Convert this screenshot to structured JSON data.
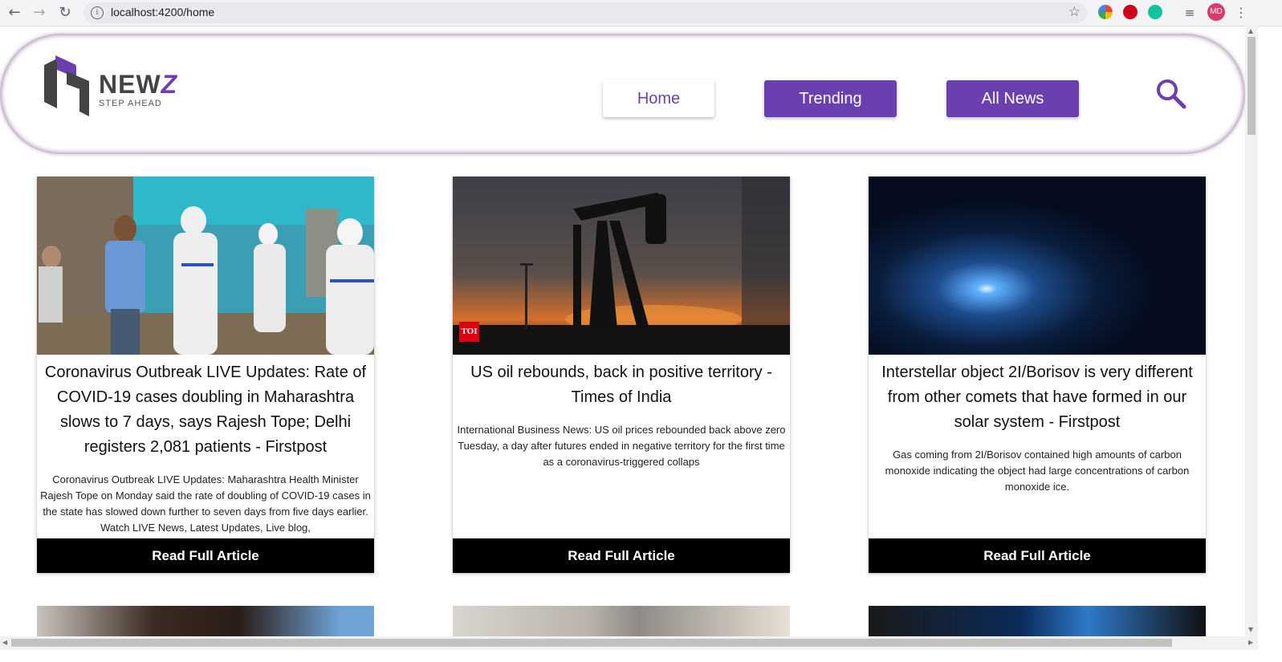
{
  "browser": {
    "url": "localhost:4200/home",
    "avatar": "MD"
  },
  "header": {
    "logo_text": "NEW",
    "logo_z": "Z",
    "tagline": "STEP AHEAD",
    "nav": [
      "Home",
      "Trending",
      "All News"
    ]
  },
  "articles": [
    {
      "title": "Coronavirus Outbreak LIVE Updates: Rate of COVID-19 cases doubling in Maharashtra slows to 7 days, says Rajesh Tope; Delhi registers 2,081 patients - Firstpost",
      "description": "Coronavirus Outbreak LIVE Updates: Maharashtra Health Minister Rajesh Tope on Monday said the rate of doubling of COVID-19 cases in the state has slowed down further to seven days from five days earlier. Watch LIVE News, Latest Updates, Live blog,",
      "button": "Read Full Article"
    },
    {
      "title": "US oil rebounds, back in positive territory - Times of India",
      "description": "International Business News: US oil prices rebounded back above zero Tuesday, a day after futures ended in negative territory for the first time as a coronavirus-triggered collaps",
      "button": "Read Full Article",
      "badge": "TOI"
    },
    {
      "title": "Interstellar object 2I/Borisov is very different from other comets that have formed in our solar system - Firstpost",
      "description": "Gas coming from 2I/Borisov contained high amounts of carbon monoxide indicating the object had large concentrations of carbon monoxide ice.",
      "button": "Read Full Article"
    }
  ]
}
